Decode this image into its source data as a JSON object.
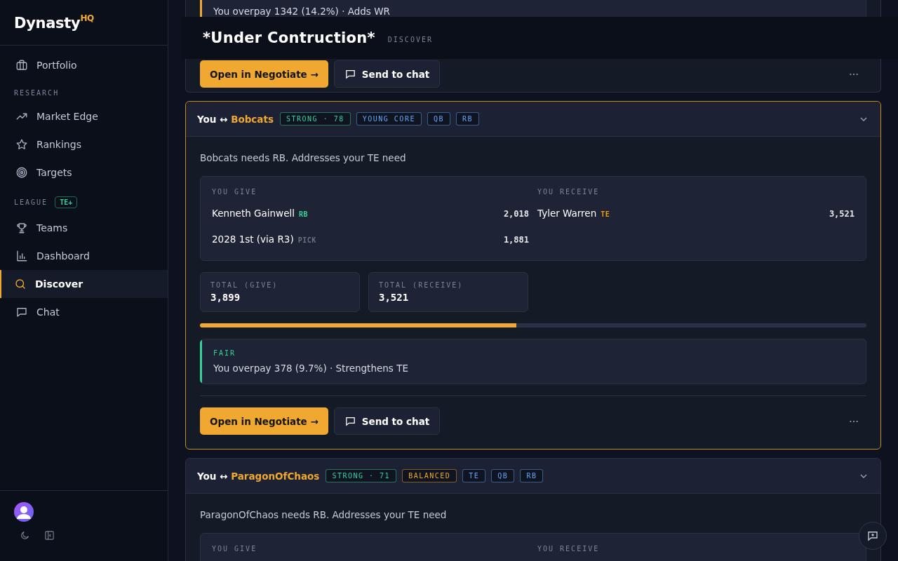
{
  "sidebar": {
    "logo": {
      "text": "Dynasty",
      "sup": "HQ"
    },
    "sections": [
      {
        "items": [
          {
            "label": "Portfolio",
            "selected": false
          }
        ]
      },
      {
        "label": "RESEARCH",
        "items": [
          {
            "label": "Market Edge",
            "selected": false
          },
          {
            "label": "Rankings",
            "selected": false
          },
          {
            "label": "Targets",
            "selected": false
          }
        ]
      },
      {
        "label": "LEAGUE",
        "badge": "TE+",
        "items": [
          {
            "label": "Teams",
            "selected": false
          },
          {
            "label": "Dashboard",
            "selected": false
          },
          {
            "label": "Discover",
            "selected": true
          },
          {
            "label": "Chat",
            "selected": false
          }
        ]
      }
    ]
  },
  "header": {
    "title": "*Under Contruction*",
    "crumb": "DISCOVER"
  },
  "cards": [
    {
      "selected": false,
      "verdict": {
        "text": "You overpay 1342 (14.2%) · Adds WR",
        "color": "#f0a830"
      },
      "buttons": [
        "Open in Negotiate →",
        "Send to chat"
      ]
    },
    {
      "selected": true,
      "you": "You ↔",
      "team": "Bobcats",
      "expanded": true,
      "tags": [
        {
          "text": "STRONG · 78",
          "color": "#34d399"
        },
        {
          "text": "YOUNG CORE",
          "color": "#60a5fa"
        },
        {
          "text": "QB",
          "color": "#60a5fa"
        },
        {
          "text": "RB",
          "color": "#60a5fa"
        }
      ],
      "description": "Bobcats needs RB. Addresses your TE need",
      "trade": {
        "give_label": "YOU GIVE",
        "receive_label": "YOU RECEIVE",
        "give": [
          {
            "name": "Kenneth Gainwell",
            "pos": "RB",
            "color": "#34d399",
            "value": "2,018"
          },
          {
            "name": "2028 1st (via R3)",
            "pos": "PICK",
            "color": "#6b7280",
            "value": "1,881"
          }
        ],
        "receive": [
          {
            "name": "Tyler Warren",
            "pos": "TE",
            "color": "#f59e0b",
            "value": "3,521"
          }
        ]
      },
      "totals": [
        {
          "label": "TOTAL (GIVE)",
          "value": "3,899"
        },
        {
          "label": "TOTAL (RECEIVE)",
          "value": "3,521"
        }
      ],
      "level": 0.475,
      "verdict": {
        "label": "FAIR",
        "text": "You overpay 378 (9.7%) · Strengthens TE",
        "color": "#34d399"
      },
      "buttons": [
        "Open in Negotiate →",
        "Send to chat"
      ]
    },
    {
      "selected": false,
      "you": "You ↔",
      "team": "ParagonOfChaos",
      "expanded": true,
      "tags": [
        {
          "text": "STRONG · 71",
          "color": "#34d399"
        },
        {
          "text": "BALANCED",
          "color": "#f0a830"
        },
        {
          "text": "TE",
          "color": "#60a5fa"
        },
        {
          "text": "QB",
          "color": "#60a5fa"
        },
        {
          "text": "RB",
          "color": "#60a5fa"
        }
      ],
      "description": "ParagonOfChaos needs RB. Addresses your TE need",
      "trade": {
        "give_label": "YOU GIVE",
        "receive_label": "YOU RECEIVE"
      }
    }
  ]
}
